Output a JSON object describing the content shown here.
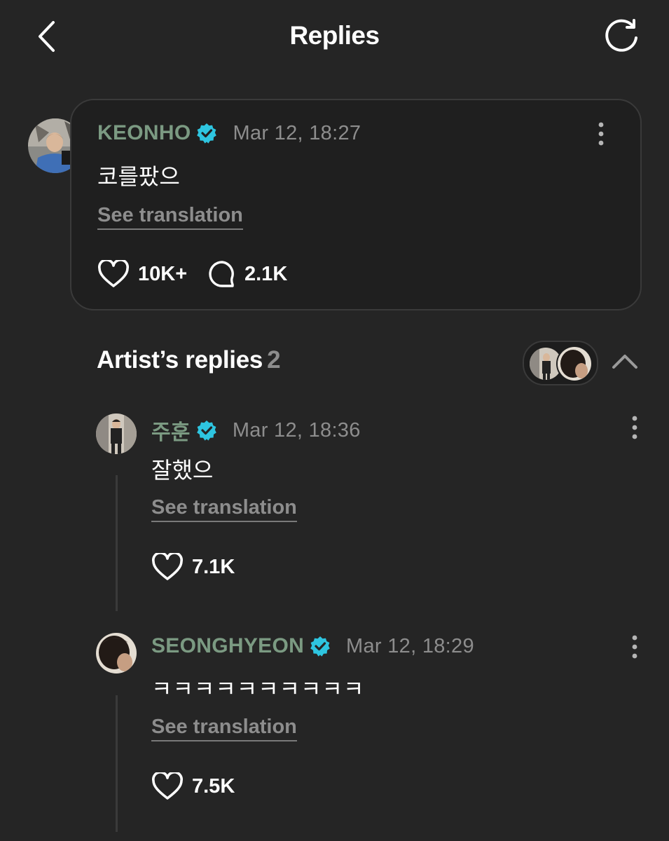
{
  "header": {
    "title": "Replies",
    "back_icon": "chevron-left-icon",
    "refresh_icon": "refresh-icon"
  },
  "post": {
    "author": "KEONHO",
    "timestamp": "Mar 12, 18:27",
    "text": "코를팠으",
    "see_translation": "See translation",
    "likes": "10K+",
    "comments": "2.1K"
  },
  "artist_replies": {
    "title": "Artist’s replies",
    "count": "2",
    "replies": [
      {
        "author": "주훈",
        "timestamp": "Mar 12, 18:36",
        "text": "잘했으",
        "see_translation": "See translation",
        "likes": "7.1K"
      },
      {
        "author": "SEONGHYEON",
        "timestamp": "Mar 12, 18:29",
        "text": "ㅋㅋㅋㅋㅋㅋㅋㅋㅋㅋ",
        "see_translation": "See translation",
        "likes": "7.5K"
      }
    ]
  },
  "colors": {
    "background": "#252525",
    "card": "#1f1f1f",
    "author_name": "#7b9a82",
    "verified_badge": "#2ec5e0",
    "muted_text": "#8d8d8d"
  }
}
